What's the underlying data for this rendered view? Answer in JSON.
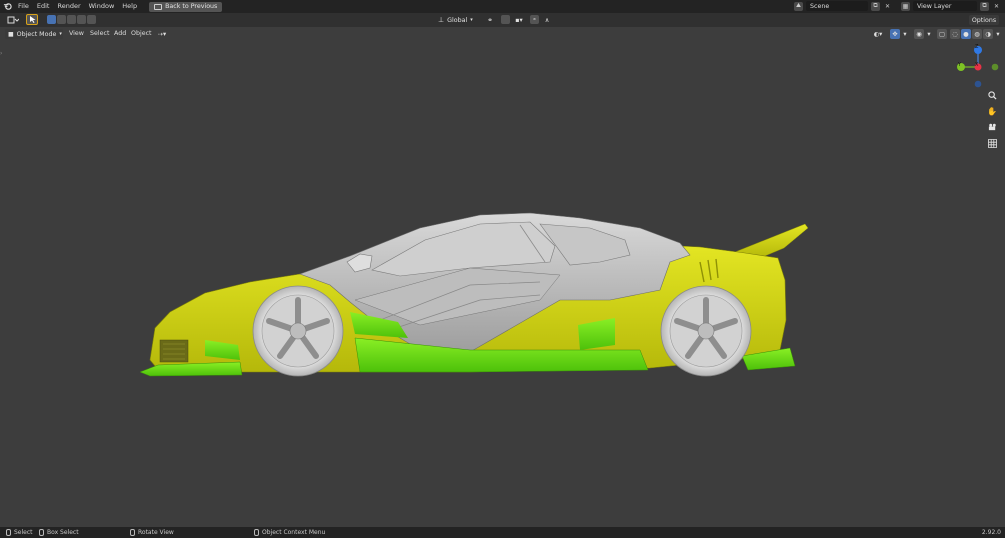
{
  "topbar": {
    "menus": [
      "File",
      "Edit",
      "Render",
      "Window",
      "Help"
    ],
    "back_label": "Back to Previous",
    "scene": "Scene",
    "view_layer": "View Layer"
  },
  "header": {
    "transform_orientation": "Global",
    "options_label": "Options"
  },
  "viewport_header": {
    "mode": "Object Mode",
    "menus": [
      "View",
      "Select",
      "Add",
      "Object"
    ]
  },
  "gizmo": {
    "z_label": "Z",
    "x_label": "X",
    "y_label": "Y"
  },
  "statusbar": {
    "select": "Select",
    "box_select": "Box Select",
    "rotate_view": "Rotate View",
    "context_menu": "Object Context Menu",
    "version": "2.92.0"
  },
  "colors": {
    "accent_blue": "#4772b3",
    "car_yellow": "#d7dc0c",
    "car_green": "#6fe60f",
    "car_body": "#c4c4c4"
  }
}
